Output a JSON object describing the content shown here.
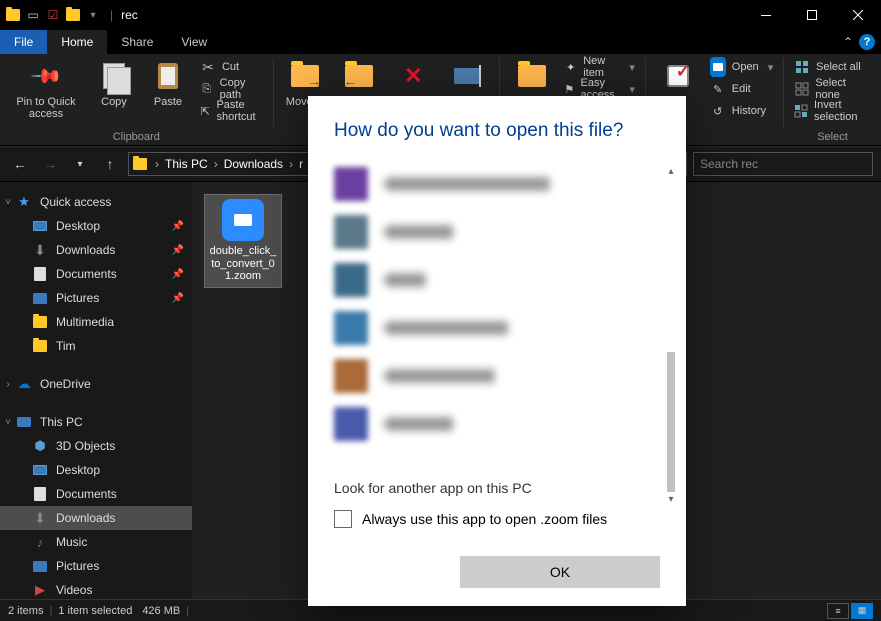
{
  "titlebar": {
    "title": "rec",
    "separator": "|"
  },
  "tabs": {
    "file": "File",
    "home": "Home",
    "share": "Share",
    "view": "View"
  },
  "ribbon": {
    "pin_label": "Pin to Quick access",
    "copy_label": "Copy",
    "paste_label": "Paste",
    "cut_label": "Cut",
    "copypath_label": "Copy path",
    "pasteshortcut_label": "Paste shortcut",
    "clipboard_group": "Clipboard",
    "moveto_label": "Move to",
    "newitem_label": "New item",
    "easyaccess_label": "Easy access",
    "open_label": "Open",
    "edit_label": "Edit",
    "history_label": "History",
    "selectall_label": "Select all",
    "selectnone_label": "Select none",
    "invert_label": "Invert selection",
    "select_group": "Select"
  },
  "breadcrumb": {
    "items": [
      "This PC",
      "Downloads"
    ],
    "partial": "r"
  },
  "search": {
    "placeholder": "Search rec"
  },
  "sidebar": {
    "quick_access": "Quick access",
    "desktop": "Desktop",
    "downloads": "Downloads",
    "documents": "Documents",
    "pictures": "Pictures",
    "multimedia": "Multimedia",
    "tim": "Tim",
    "onedrive": "OneDrive",
    "this_pc": "This PC",
    "objects_3d": "3D Objects",
    "desktop2": "Desktop",
    "documents2": "Documents",
    "downloads2": "Downloads",
    "music": "Music",
    "pictures2": "Pictures",
    "videos": "Videos"
  },
  "file": {
    "name": "double_click_to_convert_01.zoom"
  },
  "statusbar": {
    "items_count": "2 items",
    "selection": "1 item selected",
    "size": "426 MB"
  },
  "dialog": {
    "title": "How do you want to open this file?",
    "look_link": "Look for another app on this PC",
    "always_label": "Always use this app to open .zoom files",
    "ok_label": "OK"
  }
}
